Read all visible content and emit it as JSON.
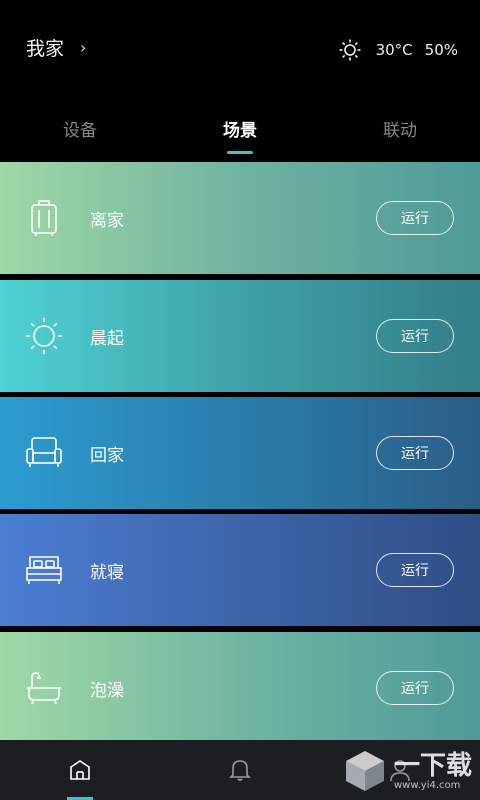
{
  "header": {
    "home_title": "我家",
    "chevron": "›",
    "temperature": "30°C",
    "humidity": "50%",
    "weather_icon": "sun-icon"
  },
  "tabs": [
    {
      "label": "设备",
      "active": false
    },
    {
      "label": "场景",
      "active": true
    },
    {
      "label": "联动",
      "active": false
    }
  ],
  "scenes": [
    {
      "name": "离家",
      "icon": "luggage-icon",
      "button": "运行"
    },
    {
      "name": "晨起",
      "icon": "sun-icon",
      "button": "运行"
    },
    {
      "name": "回家",
      "icon": "sofa-icon",
      "button": "运行"
    },
    {
      "name": "就寝",
      "icon": "bed-icon",
      "button": "运行"
    },
    {
      "name": "泡澡",
      "icon": "bathtub-icon",
      "button": "运行"
    }
  ],
  "bottom_nav": [
    {
      "icon": "home-icon",
      "active": true
    },
    {
      "icon": "bell-icon",
      "active": false
    },
    {
      "icon": "user-icon",
      "active": false
    }
  ],
  "watermark": {
    "title": "一下载",
    "url": "www.yi4.com"
  },
  "colors": {
    "accent": "#3cc2d0",
    "background": "#000000",
    "bottom_bar": "#1c1f22"
  }
}
